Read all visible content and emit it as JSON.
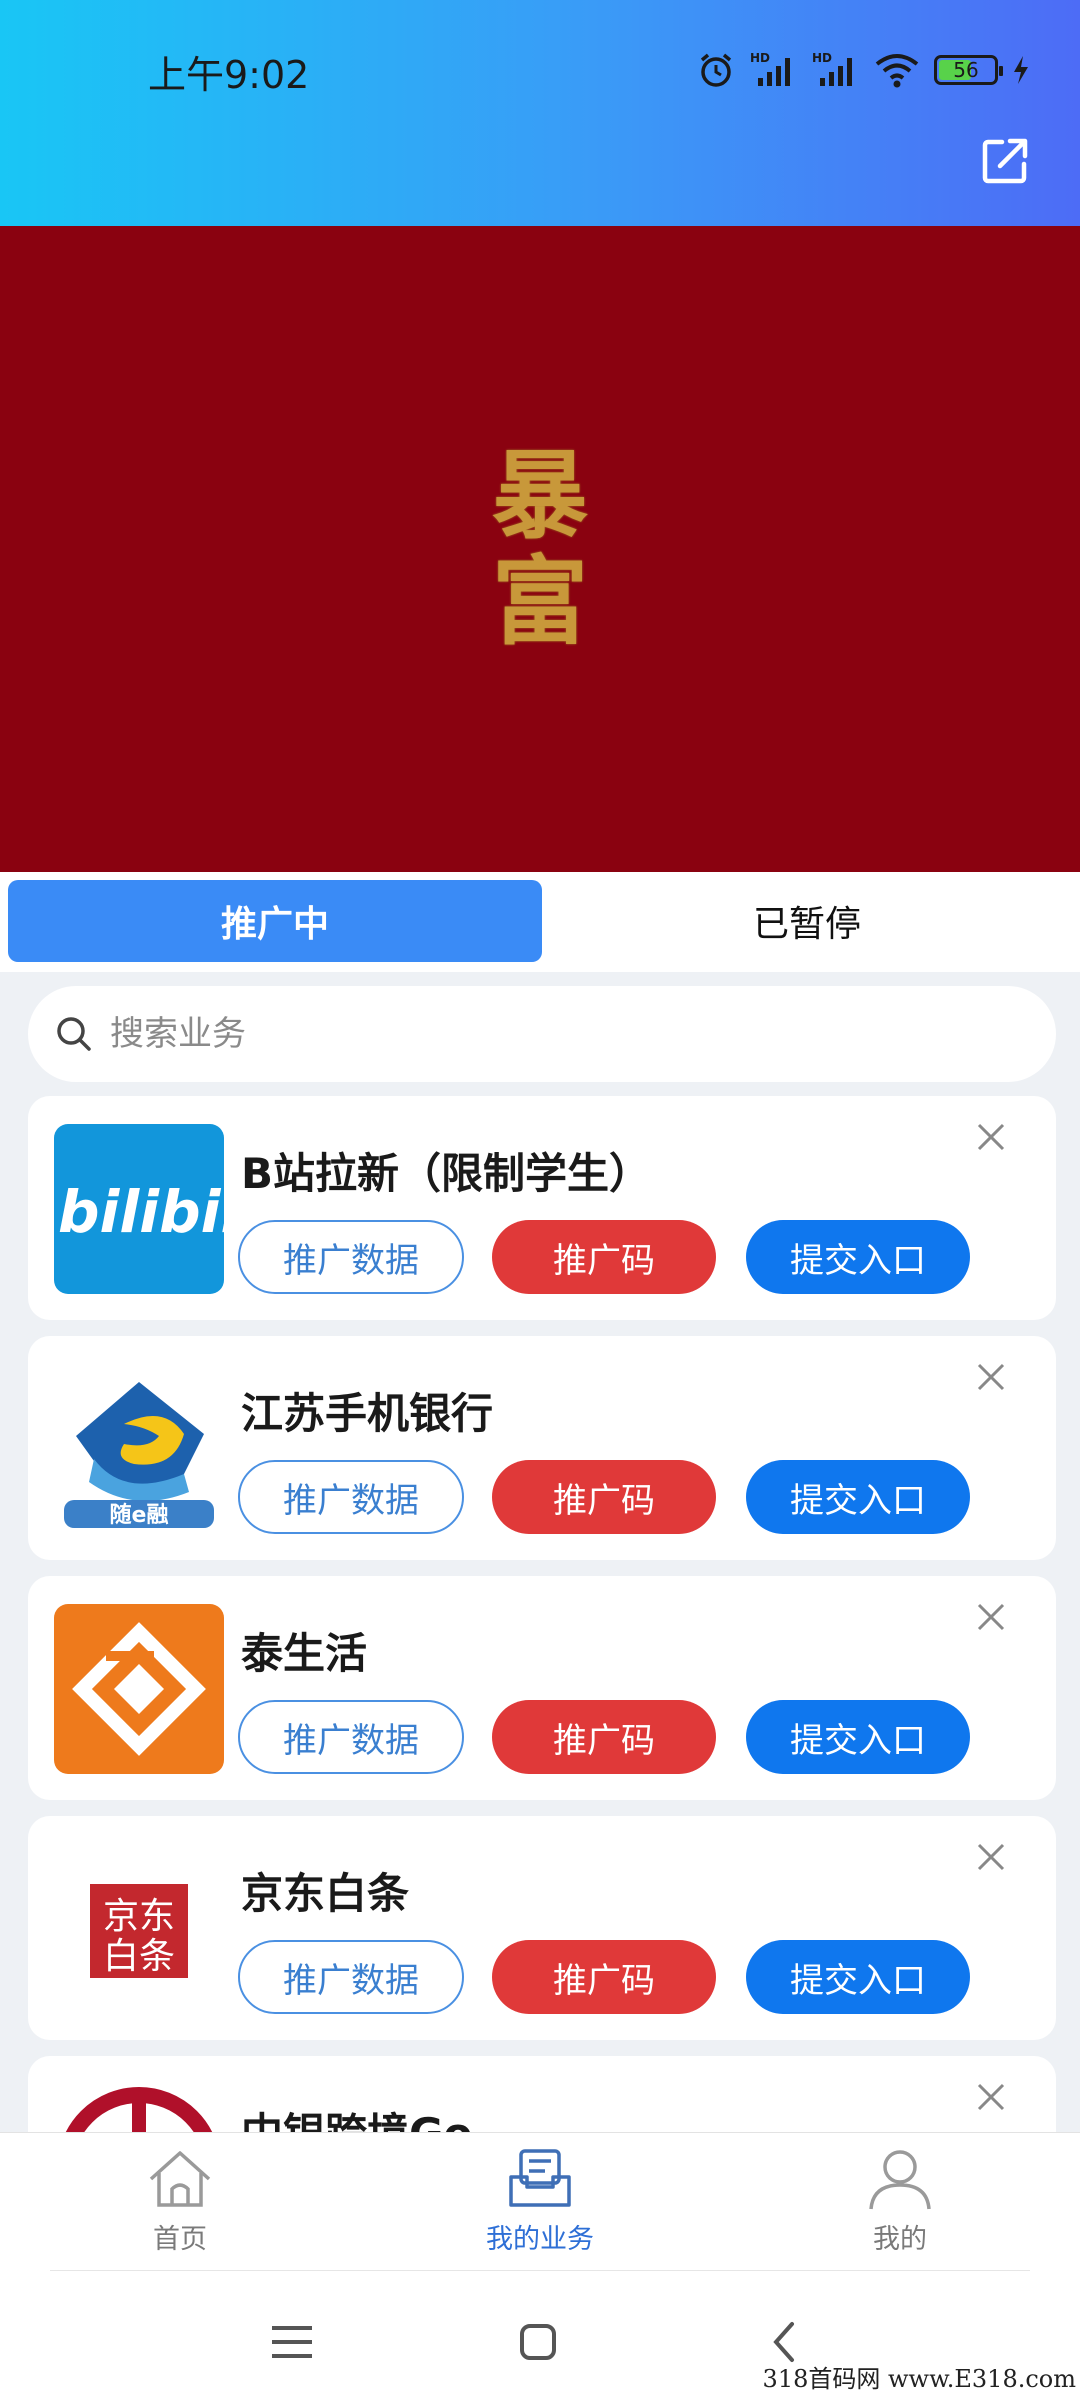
{
  "status_bar": {
    "time": "上午9:02",
    "battery": "56"
  },
  "banner": {
    "line1": "暴",
    "line2": "富"
  },
  "tabs": [
    {
      "label": "推广中"
    },
    {
      "label": "已暂停"
    }
  ],
  "search": {
    "placeholder": "搜索业务"
  },
  "buttons": {
    "data": "推广数据",
    "code": "推广码",
    "submit": "提交入口"
  },
  "items": [
    {
      "title": "B站拉新（限制学生）",
      "logo_text": "bilibili",
      "logo_color": "#1296db"
    },
    {
      "title": "江苏手机银行",
      "logo_text": "随e融",
      "logo_color": "#2b6db5"
    },
    {
      "title": "泰生活",
      "logo_color": "#ee7a1c"
    },
    {
      "title": "京东白条",
      "logo_text_1": "京东",
      "logo_text_2": "白条",
      "logo_color": "#c3282e"
    },
    {
      "title": "中银跨境Go",
      "logo_color": "#b0102a"
    }
  ],
  "nav": [
    {
      "label": "首页"
    },
    {
      "label": "我的业务"
    },
    {
      "label": "我的"
    }
  ],
  "watermark": "318首码网 www.E318.com"
}
